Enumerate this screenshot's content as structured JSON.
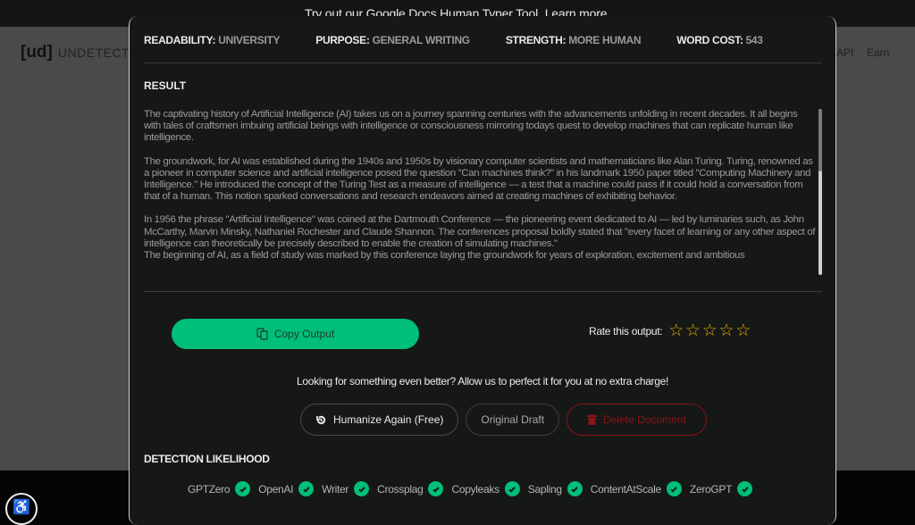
{
  "banner": {
    "text": "Try out our Google Docs Human Typer Tool.",
    "link": "Learn more."
  },
  "background": {
    "logo_mark": "[ud]",
    "logo_text": "UNDETECTA",
    "nav": [
      "API",
      "Earn"
    ]
  },
  "meta": [
    {
      "key": "READABILITY:",
      "value": "UNIVERSITY"
    },
    {
      "key": "PURPOSE:",
      "value": "GENERAL WRITING"
    },
    {
      "key": "STRENGTH:",
      "value": "MORE HUMAN"
    },
    {
      "key": "WORD COST:",
      "value": "543"
    }
  ],
  "result": {
    "title": "RESULT",
    "paragraphs": [
      "The captivating history of Artificial Intelligence (AI) takes us on a journey spanning centuries with the advancements unfolding in recent decades. It all begins with tales of craftsmen imbuing artificial beings with intelligence or consciousness mirroring todays quest to develop machines that can replicate human like intelligence.",
      "The groundwork, for AI was established during the 1940s and 1950s by visionary computer scientists and mathematicians like Alan Turing. Turing, renowned as a pioneer in computer science and artificial intelligence posed the question \"Can machines think?\" in his landmark 1950 paper titled \"Computing Machinery and Intelligence.\" He introduced the concept of the Turing Test as a measure of intelligence — a test that a machine could pass if it could hold a conversation from that of a human. This notion sparked conversations and research endeavors aimed at creating machines of exhibiting behavior.",
      "In 1956 the phrase \"Artificial Intelligence\" was coined at the Dartmouth Conference — the pioneering event dedicated to AI — led by luminaries such, as John McCarthy, Marvin Minsky, Nathaniel Rochester and Claude Shannon. The conferences proposal boldly stated that \"every facet of learning or any other aspect of intelligence can theoretically be precisely described to enable the creation of simulating machines.\"",
      "The beginning of AI, as a field of study was marked by this conference laying the groundwork for years of exploration, excitement and ambitious"
    ]
  },
  "copy_button": {
    "label": "Copy Output",
    "icon": "copy-icon"
  },
  "rating": {
    "label": "Rate this output:",
    "max": 5,
    "value": 0
  },
  "perfect_text": "Looking for something even better? Allow us to perfect it for you at no extra charge!",
  "actions": {
    "humanize": {
      "label": "Humanize Again (Free)",
      "icon": "history-icon"
    },
    "original": {
      "label": "Original Draft"
    },
    "delete": {
      "label": "Delete Document",
      "icon": "trash-icon"
    }
  },
  "detection": {
    "title": "DETECTION LIKELIHOOD",
    "detectors": [
      {
        "name": "GPTZero",
        "status": "pass"
      },
      {
        "name": "OpenAI",
        "status": "pass"
      },
      {
        "name": "Writer",
        "status": "pass"
      },
      {
        "name": "Crossplag",
        "status": "pass"
      },
      {
        "name": "Copyleaks",
        "status": "pass"
      },
      {
        "name": "Sapling",
        "status": "pass"
      },
      {
        "name": "ContentAtScale",
        "status": "pass"
      },
      {
        "name": "ZeroGPT",
        "status": "pass"
      }
    ]
  },
  "colors": {
    "accent_green": "#00bf78",
    "star_gold": "#e6ac00",
    "delete_red": "#8a1414"
  }
}
